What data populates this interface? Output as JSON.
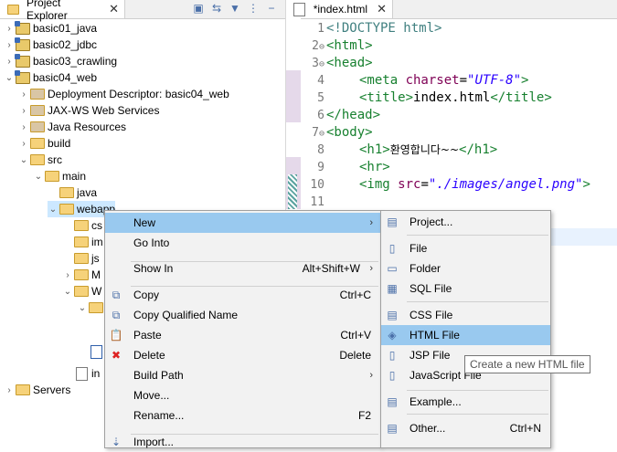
{
  "project_explorer": {
    "tab_label": "Project Explorer",
    "close_glyph": "✕",
    "tree": [
      {
        "label": "basic01_java",
        "icon": "project-icon"
      },
      {
        "label": "basic02_jdbc",
        "icon": "project-icon"
      },
      {
        "label": "basic03_crawling",
        "icon": "project-icon"
      },
      {
        "label": "basic04_web",
        "icon": "project-icon"
      },
      {
        "label": "Deployment Descriptor: basic04_web",
        "icon": "deployment-descriptor-icon"
      },
      {
        "label": "JAX-WS Web Services",
        "icon": "web-services-icon"
      },
      {
        "label": "Java Resources",
        "icon": "java-resources-icon"
      },
      {
        "label": "build",
        "icon": "folder-icon"
      },
      {
        "label": "src",
        "icon": "folder-icon"
      },
      {
        "label": "main",
        "icon": "folder-icon"
      },
      {
        "label": "java",
        "icon": "folder-icon"
      },
      {
        "label": "webapp",
        "icon": "folder-icon"
      },
      {
        "label": "cs",
        "icon": "folder-icon"
      },
      {
        "label": "im",
        "icon": "folder-icon"
      },
      {
        "label": "js",
        "icon": "folder-icon"
      },
      {
        "label": "M",
        "icon": "folder-icon"
      },
      {
        "label": "W",
        "icon": "folder-icon"
      },
      {
        "label": "",
        "icon": "folder-icon"
      },
      {
        "label": "",
        "icon": "xml-file-icon"
      },
      {
        "label": "in",
        "icon": "html-file-icon"
      },
      {
        "label": "Servers",
        "icon": "folder-icon"
      }
    ]
  },
  "editor": {
    "tab_label": "*index.html",
    "close_glyph": "✕",
    "line_numbers": [
      "1",
      "2",
      "3",
      "4",
      "5",
      "6",
      "7",
      "8",
      "9",
      "10",
      "11"
    ],
    "fold_markers": [
      "",
      "⊖",
      "⊖",
      "",
      "",
      "",
      "⊖",
      "",
      "",
      "",
      ""
    ],
    "lines": {
      "l1_doctype": "<!DOCTYPE html>",
      "l2": "<html>",
      "l3": "<head>",
      "l4_open": "<meta ",
      "l4_attr": "charset",
      "l4_eq": "=",
      "l4_val": "\"UTF-8\"",
      "l4_close": ">",
      "l5_open": "<title>",
      "l5_text": "index.html",
      "l5_close": "</title>",
      "l6": "</head>",
      "l7": "<body>",
      "l8_open": "<h1>",
      "l8_text": "환영합니다~~",
      "l8_close": "</h1>",
      "l9": "<hr>",
      "l10_open": "<img ",
      "l10_attr": "src",
      "l10_eq": "=",
      "l10_val": "\"./images/angel.png\"",
      "l10_close": ">"
    }
  },
  "context_menu": {
    "items": [
      {
        "label": "New",
        "accelerator": "",
        "submenu": true,
        "icon": ""
      },
      {
        "label": "Go Into",
        "accelerator": "",
        "submenu": false,
        "icon": ""
      },
      {
        "label": "Show In",
        "accelerator": "Alt+Shift+W",
        "submenu": true,
        "icon": ""
      },
      {
        "label": "Copy",
        "accelerator": "Ctrl+C",
        "submenu": false,
        "icon": "copy-icon"
      },
      {
        "label": "Copy Qualified Name",
        "accelerator": "",
        "submenu": false,
        "icon": "copy-icon"
      },
      {
        "label": "Paste",
        "accelerator": "Ctrl+V",
        "submenu": false,
        "icon": "paste-icon"
      },
      {
        "label": "Delete",
        "accelerator": "Delete",
        "submenu": false,
        "icon": "delete-icon"
      },
      {
        "label": "Build Path",
        "accelerator": "",
        "submenu": true,
        "icon": ""
      },
      {
        "label": "Move...",
        "accelerator": "",
        "submenu": false,
        "icon": ""
      },
      {
        "label": "Rename...",
        "accelerator": "F2",
        "submenu": false,
        "icon": ""
      },
      {
        "label": "Import...",
        "accelerator": "",
        "submenu": false,
        "icon": "import-icon"
      }
    ]
  },
  "submenu": {
    "items": [
      {
        "label": "Project...",
        "accelerator": "",
        "icon": "new-project-icon"
      },
      {
        "label": "File",
        "accelerator": "",
        "icon": "file-icon"
      },
      {
        "label": "Folder",
        "accelerator": "",
        "icon": "folder-icon"
      },
      {
        "label": "SQL File",
        "accelerator": "",
        "icon": "sql-file-icon"
      },
      {
        "label": "CSS File",
        "accelerator": "",
        "icon": "css-file-icon"
      },
      {
        "label": "HTML File",
        "accelerator": "",
        "icon": "html-file-icon"
      },
      {
        "label": "JSP File",
        "accelerator": "",
        "icon": "jsp-file-icon"
      },
      {
        "label": "JavaScript File",
        "accelerator": "",
        "icon": "javascript-file-icon"
      },
      {
        "label": "Example...",
        "accelerator": "",
        "icon": "example-icon"
      },
      {
        "label": "Other...",
        "accelerator": "Ctrl+N",
        "icon": "other-wizard-icon"
      }
    ]
  },
  "tooltip": {
    "text": "Create a new HTML file"
  },
  "colors": {
    "menu_highlight": "#99c9ef",
    "tag_green": "#17802f",
    "string_blue": "#2a00ff",
    "attr_purple": "#7f0055"
  }
}
